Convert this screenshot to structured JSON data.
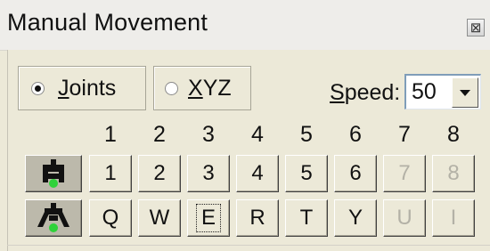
{
  "window": {
    "title": "Manual Movement",
    "close_symbol": "⊠"
  },
  "mode": {
    "options": [
      {
        "label": "Joints",
        "selected": true
      },
      {
        "label": "XYZ",
        "selected": false
      }
    ]
  },
  "speed": {
    "label": "Speed:",
    "value": "50"
  },
  "columns": [
    "1",
    "2",
    "3",
    "4",
    "5",
    "6",
    "7",
    "8"
  ],
  "rows": [
    {
      "icon": "robot-gripper-closed-icon",
      "buttons": [
        {
          "label": "1",
          "enabled": true
        },
        {
          "label": "2",
          "enabled": true
        },
        {
          "label": "3",
          "enabled": true
        },
        {
          "label": "4",
          "enabled": true
        },
        {
          "label": "5",
          "enabled": true
        },
        {
          "label": "6",
          "enabled": true
        },
        {
          "label": "7",
          "enabled": false
        },
        {
          "label": "8",
          "enabled": false
        }
      ]
    },
    {
      "icon": "robot-gripper-open-icon",
      "buttons": [
        {
          "label": "Q",
          "enabled": true
        },
        {
          "label": "W",
          "enabled": true
        },
        {
          "label": "E",
          "enabled": true,
          "focused": true
        },
        {
          "label": "R",
          "enabled": true
        },
        {
          "label": "T",
          "enabled": true
        },
        {
          "label": "Y",
          "enabled": true
        },
        {
          "label": "U",
          "enabled": false
        },
        {
          "label": "I",
          "enabled": false
        }
      ]
    }
  ],
  "colors": {
    "window_bg": "#ece9d8",
    "icon_green": "#2fd23a",
    "disabled_text": "#b3b1a6"
  }
}
